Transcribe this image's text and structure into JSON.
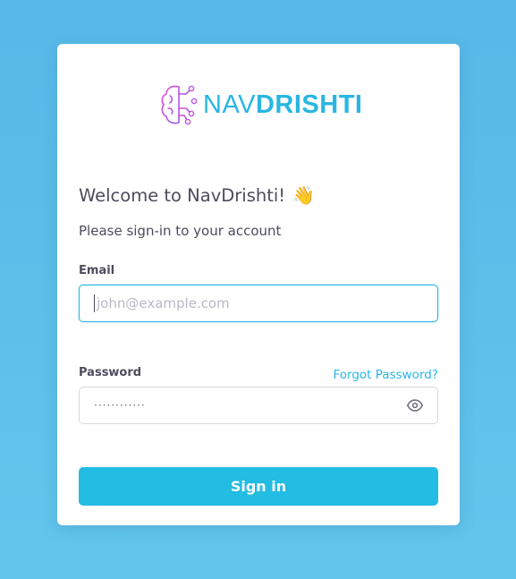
{
  "logo": {
    "brand_part1": "NAV",
    "brand_part2": "DRISHTI",
    "icon": "brain-circuit-icon",
    "brand_color": "#29b6e3"
  },
  "card": {
    "welcome_title": "Welcome to NavDrishti!",
    "welcome_emoji": "👋",
    "subtitle": "Please sign-in to your account"
  },
  "form": {
    "email_label": "Email",
    "email_placeholder": "john@example.com",
    "password_label": "Password",
    "forgot_password": "Forgot Password?",
    "password_value": "············",
    "password_toggle_icon": "eye-icon",
    "submit_label": "Sign in"
  },
  "colors": {
    "accent": "#23bce2",
    "text": "#4e4b5c",
    "background": "#5cbde9"
  }
}
